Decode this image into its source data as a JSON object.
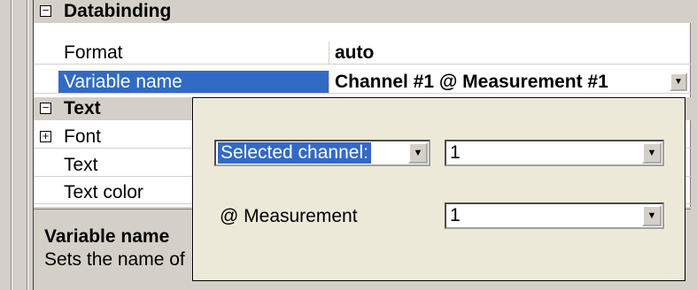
{
  "property_grid": {
    "categories": {
      "databinding": {
        "label": "Databinding",
        "toggle": "−"
      },
      "text": {
        "label": "Text",
        "toggle": "−"
      }
    },
    "rows": {
      "format": {
        "name": "Format",
        "value": "auto"
      },
      "variable_name": {
        "name": "Variable name",
        "value": "Channel #1 @ Measurement #1"
      },
      "font": {
        "name": "Font",
        "toggle": "+"
      },
      "text": {
        "name": "Text"
      },
      "text_color": {
        "name": "Text color"
      }
    }
  },
  "description": {
    "title": "Variable name",
    "text": "Sets the name of"
  },
  "popup": {
    "channel_label_combo": "Selected channel:",
    "channel_value": "1",
    "measurement_label": "@ Measurement",
    "measurement_value": "1"
  },
  "icons": {
    "dropdown": "▼"
  },
  "colors": {
    "selection": "#316ac5",
    "window_bg": "#d4d0c8",
    "popup_bg": "#ece9d8"
  }
}
